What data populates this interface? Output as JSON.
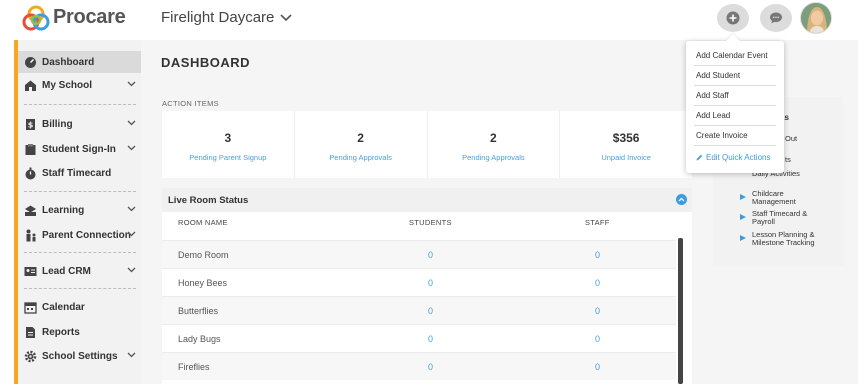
{
  "app": {
    "name": "Procare"
  },
  "header": {
    "school_name": "Firelight Daycare"
  },
  "sidebar": {
    "items": [
      {
        "label": "Dashboard"
      },
      {
        "label": "My School"
      },
      {
        "label": "Billing"
      },
      {
        "label": "Student Sign-In"
      },
      {
        "label": "Staff Timecard"
      },
      {
        "label": "Learning"
      },
      {
        "label": "Parent Connection"
      },
      {
        "label": "Lead CRM"
      },
      {
        "label": "Calendar"
      },
      {
        "label": "Reports"
      },
      {
        "label": "School Settings"
      }
    ]
  },
  "main": {
    "title": "DASHBOARD",
    "action_items_label": "ACTION ITEMS",
    "action_items": [
      {
        "value": "3",
        "label": "Pending Parent Signup"
      },
      {
        "value": "2",
        "label": "Pending Approvals"
      },
      {
        "value": "2",
        "label": "Pending Approvals"
      },
      {
        "value": "$356",
        "label": "Unpaid Invoice"
      }
    ],
    "live_room_status": {
      "title": "Live Room Status",
      "columns": [
        "ROOM NAME",
        "STUDENTS",
        "STAFF"
      ],
      "rows": [
        {
          "room": "Demo Room",
          "students": "0",
          "staff": "0"
        },
        {
          "room": "Honey Bees",
          "students": "0",
          "staff": "0"
        },
        {
          "room": "Butterflies",
          "students": "0",
          "staff": "0"
        },
        {
          "room": "Lady Bugs",
          "students": "0",
          "staff": "0"
        },
        {
          "room": "Fireflies",
          "students": "0",
          "staff": "0"
        }
      ]
    }
  },
  "quick_links": {
    "title_partial": "ks",
    "items": [
      {
        "text": "Out"
      },
      {
        "text": "ts"
      },
      {
        "text": "Daily Activities"
      },
      {
        "text": "Childcare Management"
      },
      {
        "text": "Staff Timecard & Payroll"
      },
      {
        "text": "Lesson Planning & Milestone Tracking"
      }
    ]
  },
  "quick_actions_menu": {
    "items": [
      {
        "label": "Add Calendar Event"
      },
      {
        "label": "Add Student"
      },
      {
        "label": "Add Staff"
      },
      {
        "label": "Add Lead"
      },
      {
        "label": "Create Invoice"
      }
    ],
    "edit_label": "Edit Quick Actions"
  },
  "colors": {
    "accent": "#f6a623",
    "link": "#4a9fd8",
    "toggle": "#3b9ddd"
  }
}
